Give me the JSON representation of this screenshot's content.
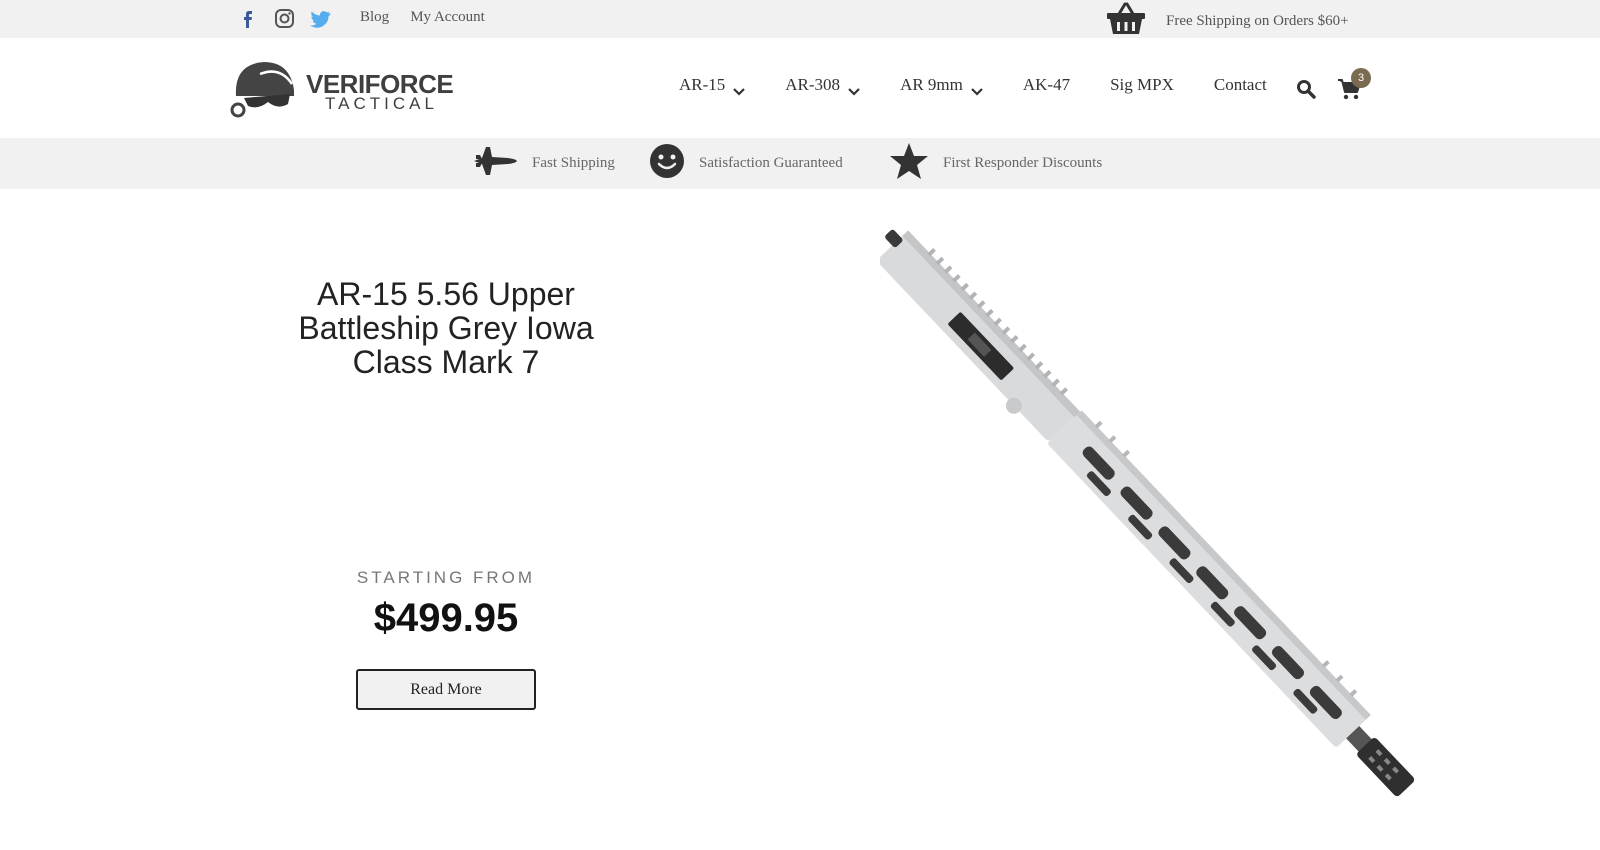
{
  "topbar": {
    "social": [
      "facebook-icon",
      "instagram-icon",
      "twitter-icon"
    ],
    "links": [
      {
        "label": "Blog"
      },
      {
        "label": "My Account"
      }
    ],
    "shipping_text": "Free Shipping on Orders $60+"
  },
  "header": {
    "logo": {
      "line1": "VERIFORCE",
      "line2": "TACTICAL"
    },
    "nav": [
      {
        "label": "AR-15",
        "has_dropdown": true
      },
      {
        "label": "AR-308",
        "has_dropdown": true
      },
      {
        "label": "AR 9mm",
        "has_dropdown": true
      },
      {
        "label": "AK-47",
        "has_dropdown": false
      },
      {
        "label": "Sig MPX",
        "has_dropdown": false
      },
      {
        "label": "Contact",
        "has_dropdown": false
      }
    ],
    "cart_count": "3"
  },
  "features": [
    {
      "icon": "jet-icon",
      "label": "Fast Shipping"
    },
    {
      "icon": "smiley-icon",
      "label": "Satisfaction Guaranteed"
    },
    {
      "icon": "star-icon",
      "label": "First Responder Discounts"
    }
  ],
  "hero": {
    "title_lines": [
      "AR-15 5.56 Upper",
      "Battleship Grey Iowa",
      "Class Mark 7"
    ],
    "starting_label": "STARTING FROM",
    "price": "$499.95",
    "button_label": "Read More"
  },
  "colors": {
    "topbar_bg": "#f1f1f1",
    "text": "#333333",
    "badge": "#7a6a4f",
    "facebook": "#3b5998",
    "twitter": "#55acee"
  }
}
